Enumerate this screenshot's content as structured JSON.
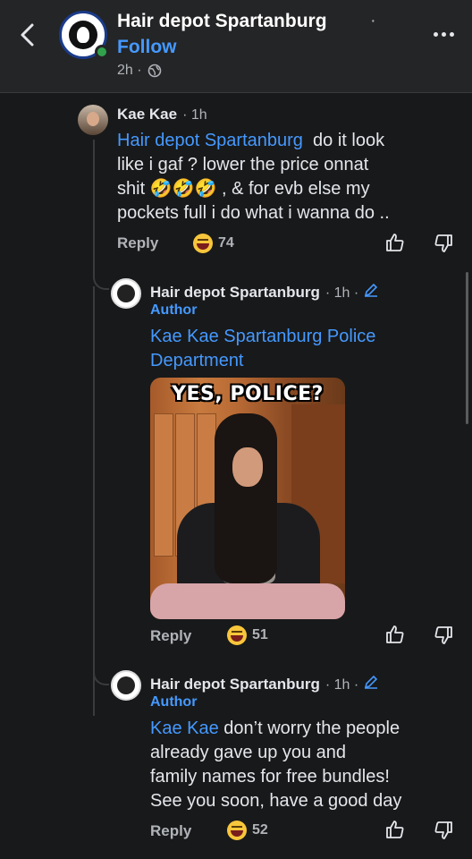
{
  "header": {
    "page_name": "Hair depot Spartanburg",
    "separator": "·",
    "follow_label": "Follow",
    "time": "2h ·",
    "globe_icon": "globe-icon",
    "more_icon": "more-horizontal-icon"
  },
  "comments": [
    {
      "author": "Kae Kae",
      "time": "· 1h",
      "mention": "Hair depot Spartanburg",
      "line1_rest": "do it look",
      "line2": "like i gaf ? lower the price onnat",
      "line3_start": "shit",
      "line3_emoji": "🤣🤣🤣",
      "line3_end": ", & for evb else my",
      "line4": "pockets full i do what i wanna do ..",
      "reply_label": "Reply",
      "reaction_count": "74"
    },
    {
      "author": "Hair depot Spartanburg",
      "time": "· 1h ·",
      "author_badge": "Author",
      "mention_line1": "Kae Kae Spartanburg Police",
      "mention_line2": "Department",
      "gif_caption": "YES, POLICE?",
      "reply_label": "Reply",
      "reaction_count": "51"
    },
    {
      "author": "Hair depot Spartanburg",
      "time": "· 1h ·",
      "author_badge": "Author",
      "mention": "Kae Kae",
      "line1_rest": "don’t worry the people",
      "line2": "already gave up you  and",
      "line3": "family names for free bundles!",
      "line4": "See you soon, have a good day",
      "reply_label": "Reply",
      "reaction_count": "52"
    }
  ],
  "colors": {
    "background": "#18191a",
    "mention": "#4599ff",
    "secondary_text": "#b0b3b8"
  }
}
